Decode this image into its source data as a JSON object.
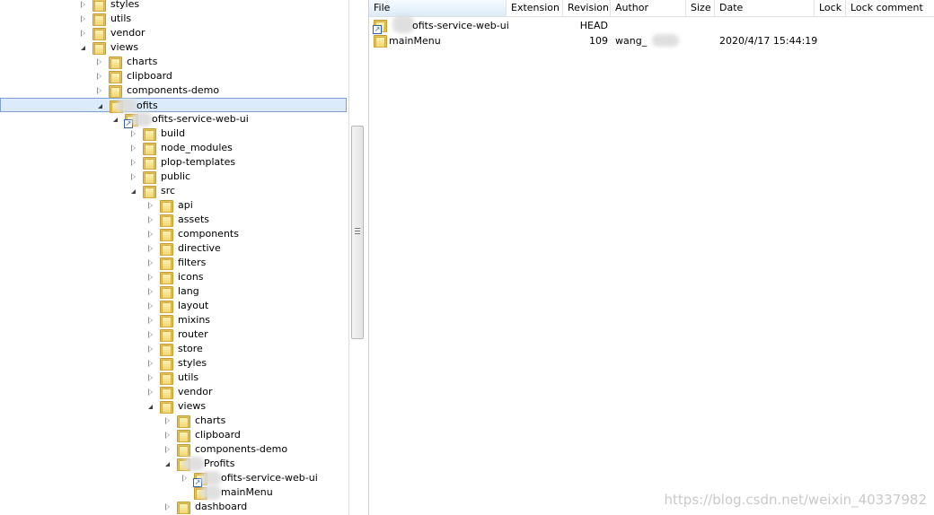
{
  "tree": [
    {
      "label": "styles",
      "depth": 0,
      "expanded": false
    },
    {
      "label": "utils",
      "depth": 0,
      "expanded": false
    },
    {
      "label": "vendor",
      "depth": 0,
      "expanded": false
    },
    {
      "label": "views",
      "depth": 0,
      "expanded": true
    },
    {
      "label": "charts",
      "depth": 1,
      "expanded": false
    },
    {
      "label": "clipboard",
      "depth": 1,
      "expanded": false
    },
    {
      "label": "components-demo",
      "depth": 1,
      "expanded": false
    },
    {
      "label": "ofits",
      "depth": 1,
      "expanded": true,
      "selected": true,
      "blur": true
    },
    {
      "label": "ofits-service-web-ui",
      "depth": 2,
      "expanded": true,
      "link": true,
      "blur": true
    },
    {
      "label": "build",
      "depth": 3,
      "expanded": false
    },
    {
      "label": "node_modules",
      "depth": 3,
      "expanded": false
    },
    {
      "label": "plop-templates",
      "depth": 3,
      "expanded": false
    },
    {
      "label": "public",
      "depth": 3,
      "expanded": false
    },
    {
      "label": "src",
      "depth": 3,
      "expanded": true
    },
    {
      "label": "api",
      "depth": 4,
      "expanded": false
    },
    {
      "label": "assets",
      "depth": 4,
      "expanded": false
    },
    {
      "label": "components",
      "depth": 4,
      "expanded": false
    },
    {
      "label": "directive",
      "depth": 4,
      "expanded": false
    },
    {
      "label": "filters",
      "depth": 4,
      "expanded": false
    },
    {
      "label": "icons",
      "depth": 4,
      "expanded": false
    },
    {
      "label": "lang",
      "depth": 4,
      "expanded": false
    },
    {
      "label": "layout",
      "depth": 4,
      "expanded": false
    },
    {
      "label": "mixins",
      "depth": 4,
      "expanded": false
    },
    {
      "label": "router",
      "depth": 4,
      "expanded": false
    },
    {
      "label": "store",
      "depth": 4,
      "expanded": false
    },
    {
      "label": "styles",
      "depth": 4,
      "expanded": false
    },
    {
      "label": "utils",
      "depth": 4,
      "expanded": false
    },
    {
      "label": "vendor",
      "depth": 4,
      "expanded": false
    },
    {
      "label": "views",
      "depth": 4,
      "expanded": true
    },
    {
      "label": "charts",
      "depth": 5,
      "expanded": false
    },
    {
      "label": "clipboard",
      "depth": 5,
      "expanded": false
    },
    {
      "label": "components-demo",
      "depth": 5,
      "expanded": false
    },
    {
      "label": "Profits",
      "depth": 5,
      "expanded": true,
      "blur": true
    },
    {
      "label": "ofits-service-web-ui",
      "depth": 6,
      "expanded": false,
      "link": true,
      "blur": true
    },
    {
      "label": "mainMenu",
      "depth": 6,
      "expanded": null,
      "blur": true
    },
    {
      "label": "dashboard",
      "depth": 5,
      "expanded": false
    }
  ],
  "columns": [
    "File",
    "Extension",
    "Revision",
    "Author",
    "Size",
    "Date",
    "Lock",
    "Lock comment"
  ],
  "files": [
    {
      "file": "ofits-service-web-ui",
      "extension": "",
      "revision": "HEAD",
      "author": "",
      "size": "",
      "date": "",
      "lock": "",
      "lock_comment": "",
      "link": true
    },
    {
      "file": "mainMenu",
      "extension": "",
      "revision": "109",
      "author": "wang_",
      "size": "",
      "date": "2020/4/17 15:44:19",
      "lock": "",
      "lock_comment": "",
      "link": false
    }
  ],
  "watermark": "https://blog.csdn.net/weixin_40337982",
  "colors": {
    "selection": "#dcebfc",
    "selection_border": "#7da2ce",
    "folder": "#e7c55a"
  }
}
